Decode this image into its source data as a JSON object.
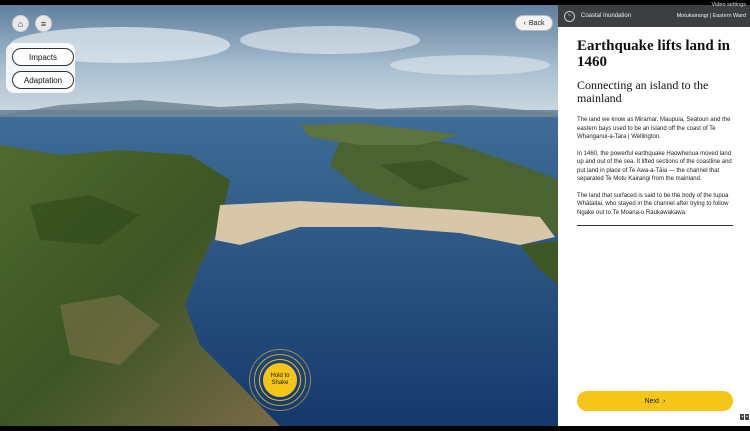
{
  "scene": {
    "home_icon": "home-icon",
    "menu_icon": "menu-icon",
    "impacts_label": "Impacts",
    "adaptation_label": "Adaptation",
    "back_label": "Back",
    "shake_label": "Hold to Shake"
  },
  "panel": {
    "app_title": "Coastal Inundation",
    "location": "Motukairangi | Eastern Ward",
    "video_settings": "Video settings",
    "title": "Earthquake lifts land in 1460",
    "subtitle": "Connecting an island to the mainland",
    "paragraphs": [
      "The land we know as Miramar, Maupuia, Seatoun and the eastern bays used to be an island off the coast of Te Whanganui-a-Tara | Wellington.",
      "In 1460, the powerful earthquake Haowhenua moved land up and out of the sea. It lifted sections of the coastline and put land in place of Te Awa-a-Tāia — the channel that separated Te Motu Kairangi from the mainland.",
      "The land that surfaced is said to be the body of the tupua Whātaitai, who stayed in the channel after trying to follow Ngake out to Te Moana-o Raukawakawa."
    ],
    "next_label": "Next"
  },
  "colors": {
    "accent": "#f5c518",
    "header_bg": "#3c3f42"
  }
}
